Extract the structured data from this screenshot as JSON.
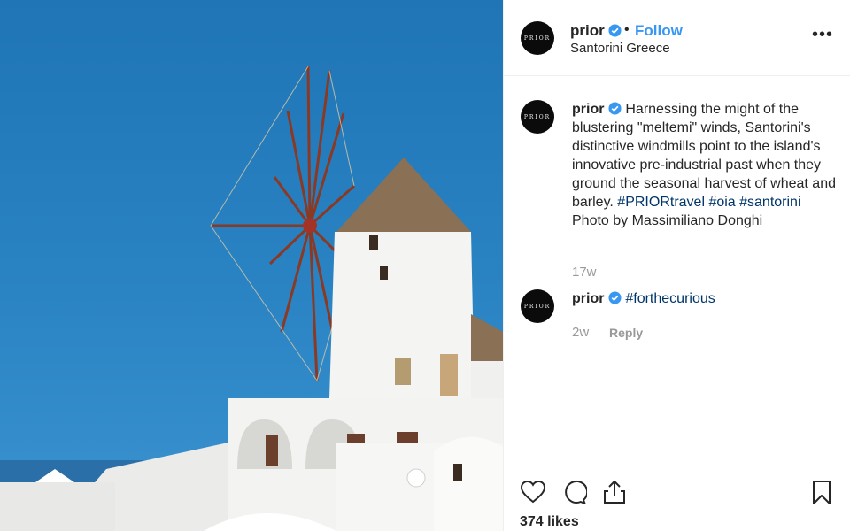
{
  "post": {
    "username": "prior",
    "avatar_text": "PRIOR",
    "follow_label": "Follow",
    "separator": "•",
    "location": "Santorini Greece",
    "more_label": "•••",
    "image_alt": "Windmill in Oia, Santorini"
  },
  "caption": {
    "username": "prior",
    "text": "Harnessing the might of the blustering \"meltemi\" winds, Santorini's distinctive windmills point to the island's innovative pre-industrial past when they ground the seasonal harvest of wheat and barley.",
    "hashtags": "#PRIORtravel #oia #santorini",
    "credit": "Photo by Massimiliano Donghi",
    "time": "17w"
  },
  "reply_comment": {
    "username": "prior",
    "text": "#forthecurious",
    "time": "2w",
    "reply_label": "Reply"
  },
  "actions": {
    "likes": "374 likes",
    "icons": [
      "heart-icon",
      "comment-icon",
      "share-icon",
      "bookmark-icon"
    ]
  },
  "colors": {
    "link_blue": "#3897f0",
    "hashtag": "#003569",
    "verified": "#3897f0",
    "muted": "#999999"
  }
}
